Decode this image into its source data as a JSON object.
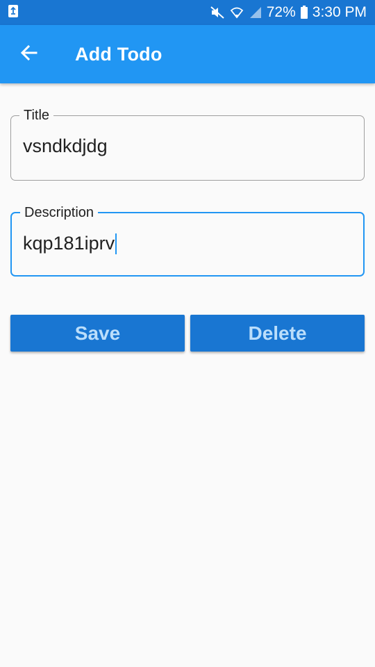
{
  "status_bar": {
    "battery_percent": "72%",
    "time": "3:30 PM",
    "icons": [
      "recycle-notification-icon",
      "mute-icon",
      "wifi-icon",
      "signal-icon",
      "battery-icon"
    ]
  },
  "app_bar": {
    "title": "Add Todo",
    "back_icon": "arrow-back-icon"
  },
  "form": {
    "title_label": "Title",
    "title_value": "vsndkdjdg",
    "description_label": "Description",
    "description_value": "kqp181iprv"
  },
  "buttons": {
    "save_label": "Save",
    "delete_label": "Delete"
  },
  "colors": {
    "status_bar": "#1976d2",
    "app_bar": "#2196f3",
    "button": "#1976d2",
    "button_text": "#bbdefb",
    "focused_border": "#2196f3"
  }
}
